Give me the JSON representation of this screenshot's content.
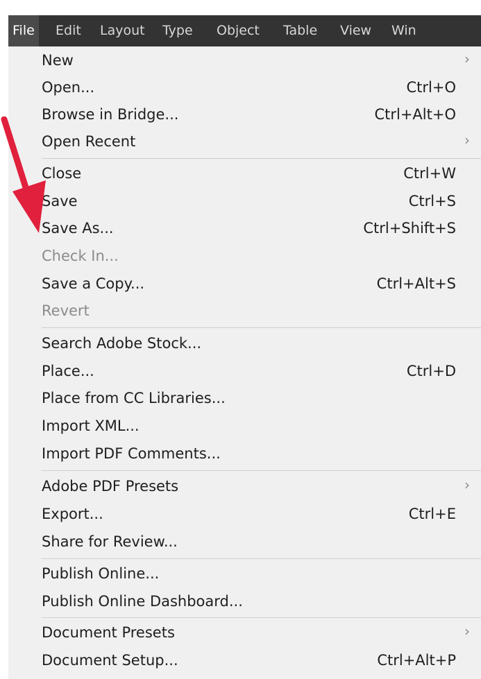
{
  "menubar": {
    "items": [
      "File",
      "Edit",
      "Layout",
      "Type",
      "Object",
      "Table",
      "View",
      "Win"
    ]
  },
  "file_menu": {
    "items": [
      {
        "label": "New",
        "shortcut": "",
        "submenu": true,
        "disabled": false
      },
      {
        "label": "Open...",
        "shortcut": "Ctrl+O",
        "submenu": false,
        "disabled": false
      },
      {
        "label": "Browse in Bridge...",
        "shortcut": "Ctrl+Alt+O",
        "submenu": false,
        "disabled": false
      },
      {
        "label": "Open Recent",
        "shortcut": "",
        "submenu": true,
        "disabled": false
      },
      {
        "label": "Close",
        "shortcut": "Ctrl+W",
        "submenu": false,
        "disabled": false
      },
      {
        "label": "Save",
        "shortcut": "Ctrl+S",
        "submenu": false,
        "disabled": false
      },
      {
        "label": "Save As...",
        "shortcut": "Ctrl+Shift+S",
        "submenu": false,
        "disabled": false
      },
      {
        "label": "Check In...",
        "shortcut": "",
        "submenu": false,
        "disabled": true
      },
      {
        "label": "Save a Copy...",
        "shortcut": "Ctrl+Alt+S",
        "submenu": false,
        "disabled": false
      },
      {
        "label": "Revert",
        "shortcut": "",
        "submenu": false,
        "disabled": true
      },
      {
        "label": "Search Adobe Stock...",
        "shortcut": "",
        "submenu": false,
        "disabled": false
      },
      {
        "label": "Place...",
        "shortcut": "Ctrl+D",
        "submenu": false,
        "disabled": false
      },
      {
        "label": "Place from CC Libraries...",
        "shortcut": "",
        "submenu": false,
        "disabled": false
      },
      {
        "label": "Import XML...",
        "shortcut": "",
        "submenu": false,
        "disabled": false
      },
      {
        "label": "Import PDF Comments...",
        "shortcut": "",
        "submenu": false,
        "disabled": false
      },
      {
        "label": "Adobe PDF Presets",
        "shortcut": "",
        "submenu": true,
        "disabled": false
      },
      {
        "label": "Export...",
        "shortcut": "Ctrl+E",
        "submenu": false,
        "disabled": false
      },
      {
        "label": "Share for Review...",
        "shortcut": "",
        "submenu": false,
        "disabled": false
      },
      {
        "label": "Publish Online...",
        "shortcut": "",
        "submenu": false,
        "disabled": false
      },
      {
        "label": "Publish Online Dashboard...",
        "shortcut": "",
        "submenu": false,
        "disabled": false
      },
      {
        "label": "Document Presets",
        "shortcut": "",
        "submenu": true,
        "disabled": false
      },
      {
        "label": "Document Setup...",
        "shortcut": "Ctrl+Alt+P",
        "submenu": false,
        "disabled": false
      }
    ],
    "submenu_glyph": "›"
  },
  "colors": {
    "menubar_bg": "#333333",
    "menu_bg": "#f0f0f0",
    "text": "#1e1e1e",
    "disabled_text": "#8b8b8b",
    "annotation_arrow": "#e0203c"
  },
  "annotation": {
    "icon": "red-arrow-icon",
    "points_to": "Save As..."
  }
}
